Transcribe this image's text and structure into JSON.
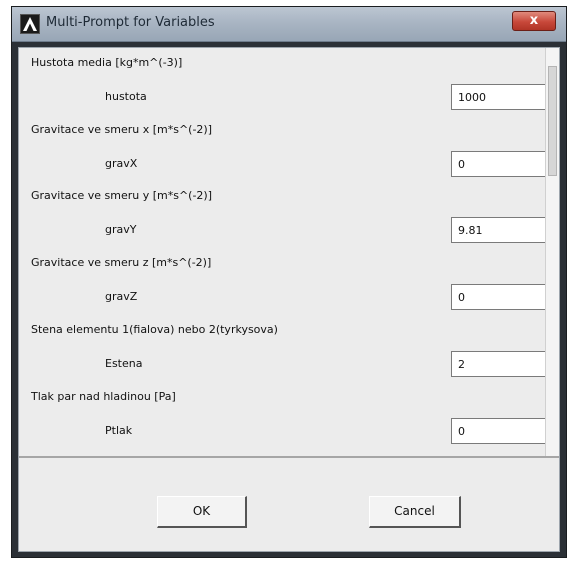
{
  "window": {
    "title": "Multi-Prompt for Variables",
    "close_glyph": "x"
  },
  "prompts": [
    {
      "caption": "Hustota media [kg*m^(-3)]",
      "name": "hustota",
      "value": "1000"
    },
    {
      "caption": "Gravitace ve smeru x [m*s^(-2)]",
      "name": "gravX",
      "value": "0"
    },
    {
      "caption": "Gravitace ve smeru y [m*s^(-2)]",
      "name": "gravY",
      "value": "9.81"
    },
    {
      "caption": "Gravitace ve smeru z [m*s^(-2)]",
      "name": "gravZ",
      "value": "0"
    },
    {
      "caption": "Stena elementu 1(fialova) nebo 2(tyrkysova)",
      "name": "Estena",
      "value": "2"
    },
    {
      "caption": "Tlak par nad hladinou [Pa]",
      "name": "Ptlak",
      "value": "0"
    }
  ],
  "buttons": {
    "ok_label": "OK",
    "cancel_label": "Cancel"
  }
}
